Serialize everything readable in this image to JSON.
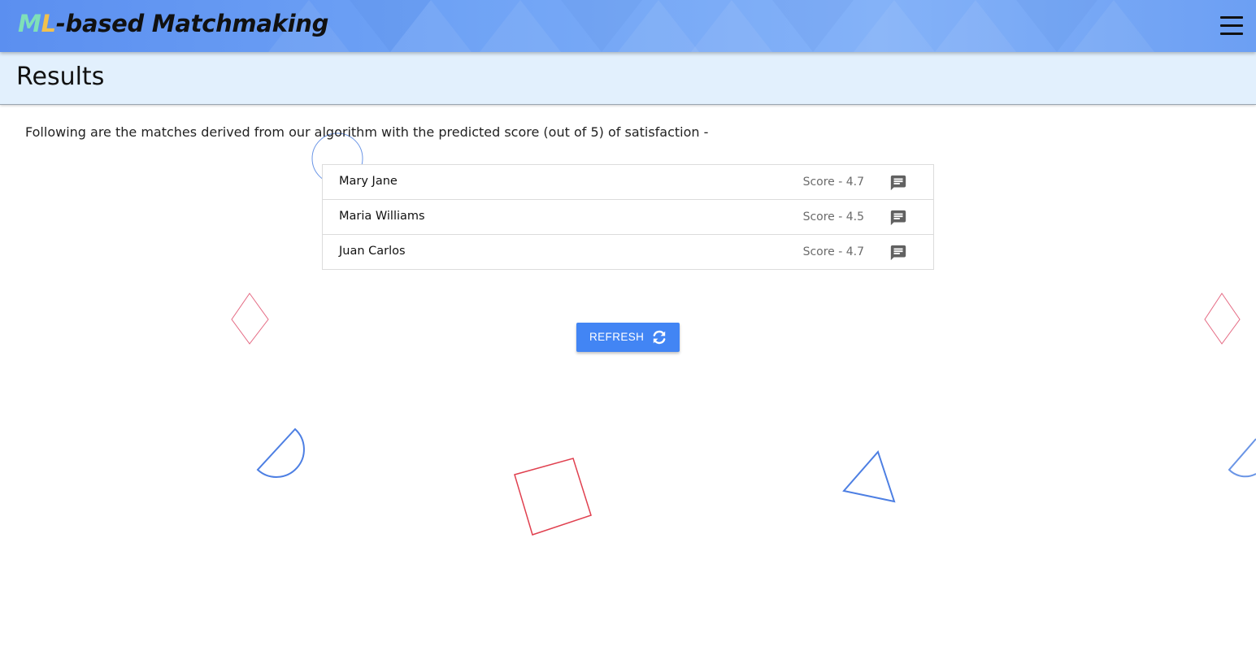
{
  "app": {
    "brand_prefix_m": "M",
    "brand_prefix_l": "L",
    "brand_rest": "-based Matchmaking",
    "menu_icon": "hamburger-menu-icon"
  },
  "header": {
    "title": "Results"
  },
  "main": {
    "intro": "Following are the matches derived from our algorithm with the predicted score (out of 5) of satisfaction -",
    "matches": [
      {
        "name": "Mary Jane",
        "score": "Score - 4.7",
        "icon": "chat-icon"
      },
      {
        "name": "Maria Williams",
        "score": "Score - 4.5",
        "icon": "chat-icon"
      },
      {
        "name": "Juan Carlos",
        "score": "Score - 4.7",
        "icon": "chat-icon"
      }
    ],
    "refresh_label": "REFRESH",
    "refresh_icon": "refresh-icon"
  },
  "colors": {
    "accent": "#4285f4",
    "header_band": "#e2f0fd",
    "brand_m": "#7fe0b8",
    "brand_l": "#f2c14e"
  }
}
